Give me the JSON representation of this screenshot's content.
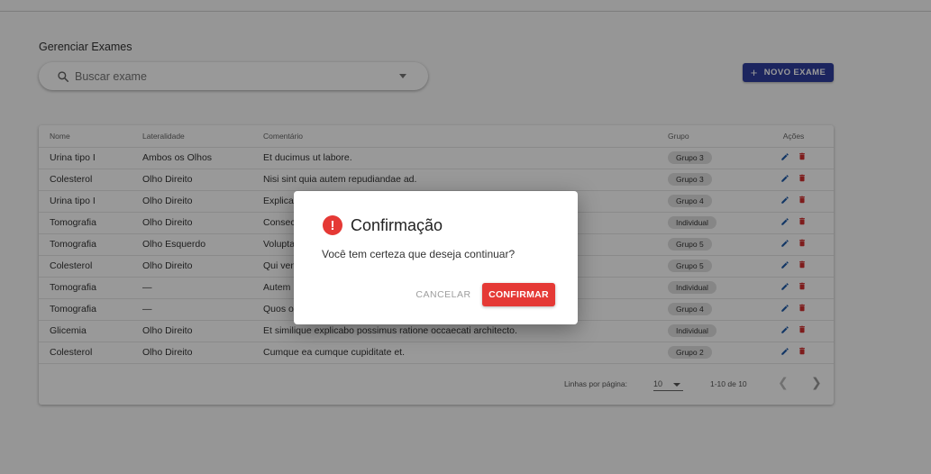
{
  "page": {
    "title": "Gerenciar Exames"
  },
  "search": {
    "placeholder": "Buscar exame"
  },
  "toolbar": {
    "new_exam_label": "NOVO EXAME"
  },
  "table": {
    "headers": {
      "nome": "Nome",
      "lateralidade": "Lateralidade",
      "comentario": "Comentário",
      "grupo": "Grupo",
      "acoes": "Ações"
    },
    "rows": [
      {
        "nome": "Urina tipo I",
        "lateralidade": "Ambos os Olhos",
        "comentario": "Et ducimus ut labore.",
        "grupo": "Grupo 3"
      },
      {
        "nome": "Colesterol",
        "lateralidade": "Olho Direito",
        "comentario": "Nisi sint quia autem repudiandae ad.",
        "grupo": "Grupo 3"
      },
      {
        "nome": "Urina tipo I",
        "lateralidade": "Olho Direito",
        "comentario": "Explica",
        "grupo": "Grupo 4"
      },
      {
        "nome": "Tomografia",
        "lateralidade": "Olho Direito",
        "comentario": "Consec",
        "grupo": "Individual"
      },
      {
        "nome": "Tomografia",
        "lateralidade": "Olho Esquerdo",
        "comentario": "Volupta",
        "grupo": "Grupo 5"
      },
      {
        "nome": "Colesterol",
        "lateralidade": "Olho Direito",
        "comentario": "Qui ven",
        "grupo": "Grupo 5"
      },
      {
        "nome": "Tomografia",
        "lateralidade": "—",
        "comentario": "Autem",
        "grupo": "Individual"
      },
      {
        "nome": "Tomografia",
        "lateralidade": "—",
        "comentario": "Quos o",
        "grupo": "Grupo 4"
      },
      {
        "nome": "Glicemia",
        "lateralidade": "Olho Direito",
        "comentario": "Et similique explicabo possimus ratione occaecati architecto.",
        "grupo": "Individual"
      },
      {
        "nome": "Colesterol",
        "lateralidade": "Olho Direito",
        "comentario": "Cumque ea cumque cupiditate et.",
        "grupo": "Grupo 2"
      }
    ]
  },
  "pagination": {
    "rows_per_page_label": "Linhas por página:",
    "rows_per_page": "10",
    "range": "1-10 de 10"
  },
  "dialog": {
    "title": "Confirmação",
    "message": "Você tem certeza que deseja continuar?",
    "cancel_label": "CANCELAR",
    "confirm_label": "CONFIRMAR",
    "warn_glyph": "!"
  },
  "icons": {
    "edit": "pencil-icon",
    "delete": "trash-icon",
    "search": "search-icon",
    "add": "plus-icon",
    "warning": "exclamation-circle-icon"
  },
  "colors": {
    "primary": "#303f9f",
    "danger": "#e53935",
    "edit_icon": "#1e5aa8",
    "delete_icon": "#d32f2f"
  }
}
